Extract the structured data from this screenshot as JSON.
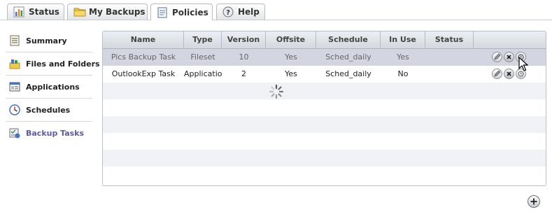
{
  "tabs": [
    {
      "label": "Status",
      "icon": "bar-chart-icon",
      "active": false
    },
    {
      "label": "My Backups",
      "icon": "folder-icon",
      "active": false
    },
    {
      "label": "Policies",
      "icon": "document-icon",
      "active": true
    },
    {
      "label": "Help",
      "icon": "help-icon",
      "active": false
    }
  ],
  "sidebar": {
    "items": [
      {
        "label": "Summary",
        "icon": "summary-document-icon",
        "active": false
      },
      {
        "label": "Files and Folders",
        "icon": "files-folders-icon",
        "active": false
      },
      {
        "label": "Applications",
        "icon": "applications-icon",
        "active": false
      },
      {
        "label": "Schedules",
        "icon": "clock-icon",
        "active": false
      },
      {
        "label": "Backup Tasks",
        "icon": "backup-tasks-icon",
        "active": true
      }
    ]
  },
  "grid": {
    "columns": [
      "Name",
      "Type",
      "Version",
      "Offsite",
      "Schedule",
      "In Use",
      "Status",
      ""
    ],
    "rows": [
      {
        "name": "Pics Backup Task",
        "type": "Fileset",
        "version": "10",
        "offsite": "Yes",
        "schedule": "Sched_daily",
        "in_use": "Yes",
        "status": "",
        "selected": true
      },
      {
        "name": "OutlookExp Task",
        "type": "Applicatior",
        "version": "2",
        "offsite": "Yes",
        "schedule": "Sched_daily",
        "in_use": "No",
        "status": "",
        "selected": false
      }
    ],
    "row_actions": [
      "edit-icon",
      "delete-icon",
      "restore-icon"
    ],
    "loading": true
  },
  "colors": {
    "accent": "#5a5aa0",
    "selected_row": "#d3d6e0",
    "header_top": "#eceef2",
    "header_bottom": "#d4d8df",
    "border": "#b9c0cc"
  }
}
